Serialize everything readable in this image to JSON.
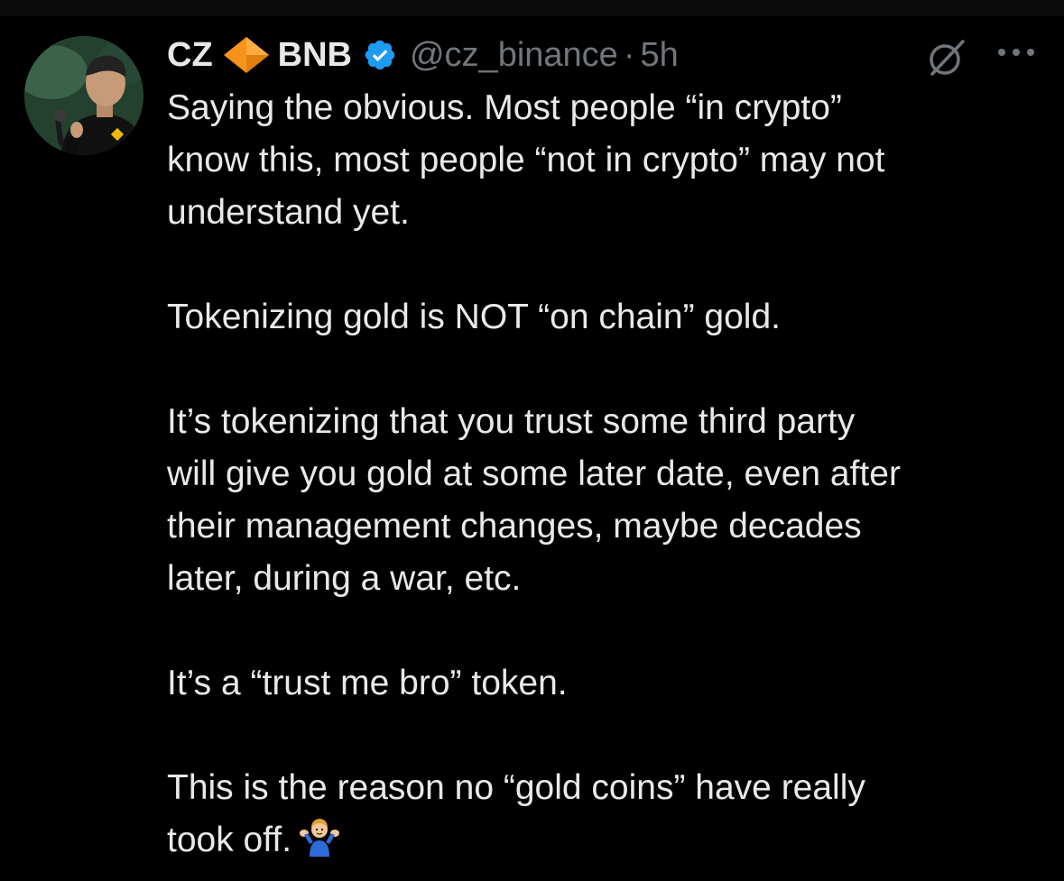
{
  "tweet": {
    "author": {
      "name_first": "CZ",
      "name_second": "BNB",
      "handle": "@cz_binance",
      "separator": "·",
      "time": "5h",
      "avatar_icon": "profile-photo",
      "badge_icon": "verified-badge-icon",
      "verified_color": "#1d9bf0",
      "diamond_icon": "orange-diamond-emoji",
      "diamond_color": "#f7931a"
    },
    "actions": {
      "grok_icon": "grok-icon",
      "more_icon": "more-options-icon"
    },
    "paragraphs": [
      {
        "lines": [
          "Saying the obvious. Most people “in crypto”",
          "know this, most people “not in crypto” may not",
          "understand yet."
        ]
      },
      {
        "lines": [
          "Tokenizing gold is NOT “on chain” gold."
        ]
      },
      {
        "lines": [
          "It’s tokenizing that you trust some third party",
          "will give you gold at some later date, even after",
          "their management changes, maybe decades",
          "later, during a war, etc."
        ]
      },
      {
        "lines": [
          "It’s a “trust me bro” token."
        ]
      },
      {
        "lines": [
          "This is the reason no “gold coins” have really",
          "took off."
        ]
      }
    ],
    "closing_emoji": "person-shrugging-emoji"
  }
}
